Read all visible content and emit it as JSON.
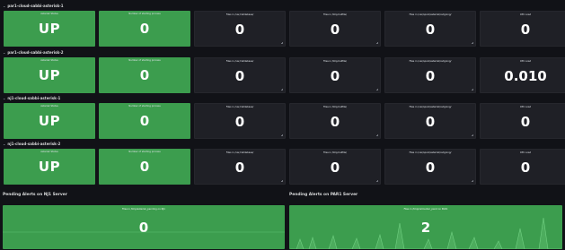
{
  "panel_titles": {
    "asterisk_status": "Asterisk Status",
    "starting_process": "Number of starting process",
    "files_var_calldebase": "Files in /var/calldebase/",
    "files_tmp_callfiles": "Files in /tmp/callfile/",
    "files_outgoing": "Files in /var/spool/asterisk/outgoing/",
    "cpu_load": "CPU Load"
  },
  "rows": [
    {
      "title": "par1-cloud-sabbi-asterisk-1",
      "values": {
        "status": "UP",
        "starting": "0",
        "calldebase": "0",
        "callfiles": "0",
        "outgoing": "0",
        "cpu": "0"
      }
    },
    {
      "title": "par1-cloud-sabbi-asterisk-2",
      "values": {
        "status": "UP",
        "starting": "0",
        "calldebase": "0",
        "callfiles": "0",
        "outgoing": "0",
        "cpu": "0.010"
      }
    },
    {
      "title": "nj1-cloud-sabbi-asterisk-1",
      "values": {
        "status": "UP",
        "starting": "0",
        "calldebase": "0",
        "callfiles": "0",
        "outgoing": "0",
        "cpu": "0"
      }
    },
    {
      "title": "nj1-cloud-sabbi-asterisk-2",
      "values": {
        "status": "UP",
        "starting": "0",
        "calldebase": "0",
        "callfiles": "0",
        "outgoing": "0",
        "cpu": "0"
      }
    }
  ],
  "pending": {
    "nj1": {
      "section_title": "Pending Alerts on NJ1 Server",
      "panel_title": "Files in /tmp/asterisk_pending on NJ1",
      "value": "0"
    },
    "par1": {
      "section_title": "Pending Alerts on PAR1 Server",
      "panel_title": "Files in /tmp/callcenter_pend on PAR1",
      "value": "2"
    }
  },
  "colors": {
    "ok_green": "#3c9d4e",
    "panel_dark": "#1f2026",
    "background": "#111217",
    "sparkline": "#5fbf72"
  },
  "icons": {
    "row_collapse": "chevron-down-icon"
  }
}
